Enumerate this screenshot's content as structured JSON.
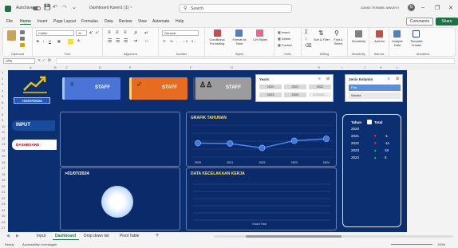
{
  "window": {
    "autosave": "AutoSave",
    "file_name": "Dashboard Karen1 (1) ~",
    "search_placeholder": "Search",
    "user_name": "GANDI TERABB JANUEVI",
    "user_initial": "G"
  },
  "menu": {
    "items": [
      "File",
      "Home",
      "Insert",
      "Page Layout",
      "Formulas",
      "Data",
      "Review",
      "View",
      "Automate",
      "Help"
    ],
    "active": "Home",
    "comments_label": "Comments",
    "share_label": "Share"
  },
  "ribbon": {
    "groups": [
      "Clipboard",
      "Font",
      "Alignment",
      "Number",
      "Styles",
      "Cells",
      "Editing",
      "Sensitivity",
      "Add-ins",
      "AI/AddIns"
    ],
    "font_name": "Calibri",
    "font_size": "11",
    "number_format": "General",
    "styles": [
      "Conditional Formatting",
      "Format as Table",
      "Cell Styles"
    ],
    "cells": [
      "Insert",
      "Delete",
      "Format"
    ],
    "editing": [
      "Sort & Filter",
      "Find & Select"
    ],
    "extras": [
      "Sensitivity",
      "Add-ins",
      "Analyze Data",
      "Template Creator"
    ]
  },
  "formula_bar": {
    "name_box": "AT5",
    "fx": "fx"
  },
  "columns": [
    "A",
    "B",
    "C",
    "D",
    "E",
    "F",
    "G",
    "H",
    "I",
    "J",
    "K",
    "L"
  ],
  "rows": [
    "1",
    "2",
    "3",
    "4",
    "5",
    "6",
    "7",
    "8",
    "9",
    "10",
    "11",
    "12",
    "13",
    "14",
    "15",
    "16",
    "17",
    "18",
    "19",
    "20",
    "21",
    "22",
    "23",
    "24",
    "25",
    "26",
    "27"
  ],
  "dashboard": {
    "date_badge": ">01/07/2024",
    "cards": [
      {
        "label": "STAFF",
        "color": "#4a74d6",
        "icon": "female-icon"
      },
      {
        "label": "STAFF",
        "color": "#e66c1f",
        "icon": "male-icon"
      },
      {
        "label": "STAFF",
        "color": "#9c9c9c",
        "icon": "people-icon"
      }
    ],
    "nav": [
      "INPUT",
      "DASHBOARD"
    ],
    "years_slicer": {
      "title": "Years",
      "items": [
        "2020",
        "2021",
        "2022",
        "2023",
        "2024",
        "2025/02..."
      ]
    },
    "gender_slicer": {
      "title": "Jenis Kelamin",
      "items": [
        "Pria",
        "Wanita"
      ]
    },
    "date_panel_label": ">01/07/2024",
    "line_chart_title": "GRAFIK TAHUNAN",
    "accident_title": "DATA KECELAKAAN KERJA",
    "accident_footer": "Grand Total",
    "year_table": {
      "headers": [
        "Tahun",
        "Total"
      ],
      "rows": [
        {
          "year": "2020",
          "arrow": "",
          "value": ""
        },
        {
          "year": "2021",
          "arrow": "▼",
          "value": "-1"
        },
        {
          "year": "2022",
          "arrow": "▼",
          "value": "-11"
        },
        {
          "year": "2023",
          "arrow": "▲",
          "value": "18"
        },
        {
          "year": "2024",
          "arrow": "▲",
          "value": "5"
        }
      ]
    },
    "accent_color": "#ffe44d"
  },
  "chart_data": {
    "type": "line",
    "title": "GRAFIK TAHUNAN",
    "x": [
      "2020",
      "2021",
      "2022",
      "2023",
      "2024"
    ],
    "values": [
      35,
      34,
      23,
      41,
      46
    ],
    "ylim": [
      0,
      80
    ],
    "grid": true
  },
  "sheet_tabs": {
    "tabs": [
      "Input",
      "Dashboard",
      "Drop down list",
      "Pivot Table"
    ],
    "active": "Dashboard",
    "add": "+"
  },
  "status_bar": {
    "ready": "Ready",
    "accessibility": "Accessibility: Investigate",
    "zoom": "100%"
  }
}
